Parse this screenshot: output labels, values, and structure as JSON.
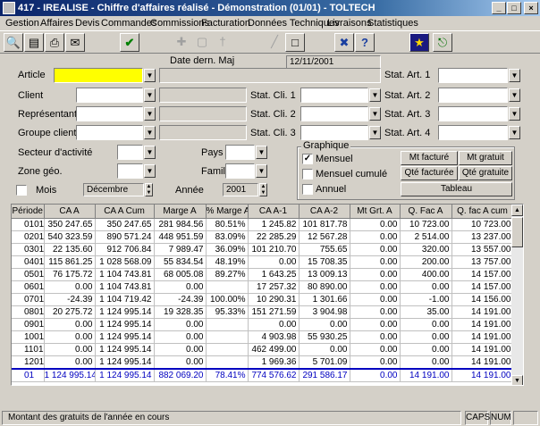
{
  "window": {
    "title": "417 - IREALISE - Chiffre d'affaires réalisé - Démonstration (01/01) - TOLTECH"
  },
  "menu": [
    "Gestion",
    "Affaires",
    "Devis",
    "Commandes",
    "Commissions",
    "Facturation",
    "Données Techniques",
    "Livraisons",
    "Statistiques"
  ],
  "toolbar": {
    "icons": [
      "search-icon",
      "camera-icon",
      "print-icon",
      "mail-icon",
      "ok-check-icon",
      "add-icon",
      "delete-icon",
      "tool-icon",
      "edit-icon",
      "blank-page-icon",
      "tools-icon",
      "help-icon",
      "wizard-icon",
      "exit-icon"
    ]
  },
  "form": {
    "date_label": "Date dern. Maj",
    "date_value": "12/11/2001",
    "labels": {
      "article": "Article",
      "client": "Client",
      "representant": "Représentant",
      "groupe_client": "Groupe client",
      "secteur": "Secteur d'activité",
      "zone": "Zone géo.",
      "pays": "Pays",
      "famille": "Famille",
      "mois": "Mois",
      "annee": "Année",
      "stat_cli_1": "Stat. Cli. 1",
      "stat_cli_2": "Stat. Cli. 2",
      "stat_cli_3": "Stat. Cli. 3",
      "stat_art_1": "Stat. Art. 1",
      "stat_art_2": "Stat. Art. 2",
      "stat_art_3": "Stat. Art. 3",
      "stat_art_4": "Stat. Art. 4"
    },
    "mois_value": "Décembre",
    "annee_value": "2001",
    "graphique": {
      "legend": "Graphique",
      "mensuel": "Mensuel",
      "mensuel_cumule": "Mensuel cumulé",
      "annuel": "Annuel",
      "mensuel_checked": true,
      "buttons": {
        "mt_facture": "Mt facturé",
        "mt_gratuit": "Mt gratuit",
        "qte_facturee": "Qté facturée",
        "qte_gratuite": "Qté gratuite",
        "tableau": "Tableau"
      }
    }
  },
  "grid": {
    "columns": [
      "Période",
      "CA A",
      "CA A Cum",
      "Marge A",
      "% Marge A",
      "CA A-1",
      "CA A-2",
      "Mt Grt. A",
      "Q. Fac A",
      "Q. fac A cum"
    ],
    "rows": [
      [
        "0101",
        "350 247.65",
        "350 247.65",
        "281 984.56",
        "80.51%",
        "1 245.82",
        "101 817.78",
        "0.00",
        "10 723.00",
        "10 723.00"
      ],
      [
        "0201",
        "540 323.59",
        "890 571.24",
        "448 951.59",
        "83.09%",
        "22 285.29",
        "12 567.28",
        "0.00",
        "2 514.00",
        "13 237.00"
      ],
      [
        "0301",
        "22 135.60",
        "912 706.84",
        "7 989.47",
        "36.09%",
        "101 210.70",
        "755.65",
        "0.00",
        "320.00",
        "13 557.00"
      ],
      [
        "0401",
        "115 861.25",
        "1 028 568.09",
        "55 834.54",
        "48.19%",
        "0.00",
        "15 708.35",
        "0.00",
        "200.00",
        "13 757.00"
      ],
      [
        "0501",
        "76 175.72",
        "1 104 743.81",
        "68 005.08",
        "89.27%",
        "1 643.25",
        "13 009.13",
        "0.00",
        "400.00",
        "14 157.00"
      ],
      [
        "0601",
        "0.00",
        "1 104 743.81",
        "0.00",
        "",
        "17 257.32",
        "80 890.00",
        "0.00",
        "0.00",
        "14 157.00"
      ],
      [
        "0701",
        "-24.39",
        "1 104 719.42",
        "-24.39",
        "100.00%",
        "10 290.31",
        "1 301.66",
        "0.00",
        "-1.00",
        "14 156.00"
      ],
      [
        "0801",
        "20 275.72",
        "1 124 995.14",
        "19 328.35",
        "95.33%",
        "151 271.59",
        "3 904.98",
        "0.00",
        "35.00",
        "14 191.00"
      ],
      [
        "0901",
        "0.00",
        "1 124 995.14",
        "0.00",
        "",
        "0.00",
        "0.00",
        "0.00",
        "0.00",
        "14 191.00"
      ],
      [
        "1001",
        "0.00",
        "1 124 995.14",
        "0.00",
        "",
        "4 903.98",
        "55 930.25",
        "0.00",
        "0.00",
        "14 191.00"
      ],
      [
        "1101",
        "0.00",
        "1 124 995.14",
        "0.00",
        "",
        "462 499.00",
        "0.00",
        "0.00",
        "0.00",
        "14 191.00"
      ],
      [
        "1201",
        "0.00",
        "1 124 995.14",
        "0.00",
        "",
        "1 969.36",
        "5 701.09",
        "0.00",
        "0.00",
        "14 191.00"
      ]
    ],
    "total": [
      "01",
      "1 124 995.14",
      "1 124 995.14",
      "882 069.20",
      "78.41%",
      "774 576.62",
      "291 586.17",
      "0.00",
      "14 191.00",
      "14 191.00"
    ]
  },
  "statusbar": {
    "message": "Montant des gratuits de l'année en cours",
    "caps": "CAPS",
    "num": "NUM"
  }
}
